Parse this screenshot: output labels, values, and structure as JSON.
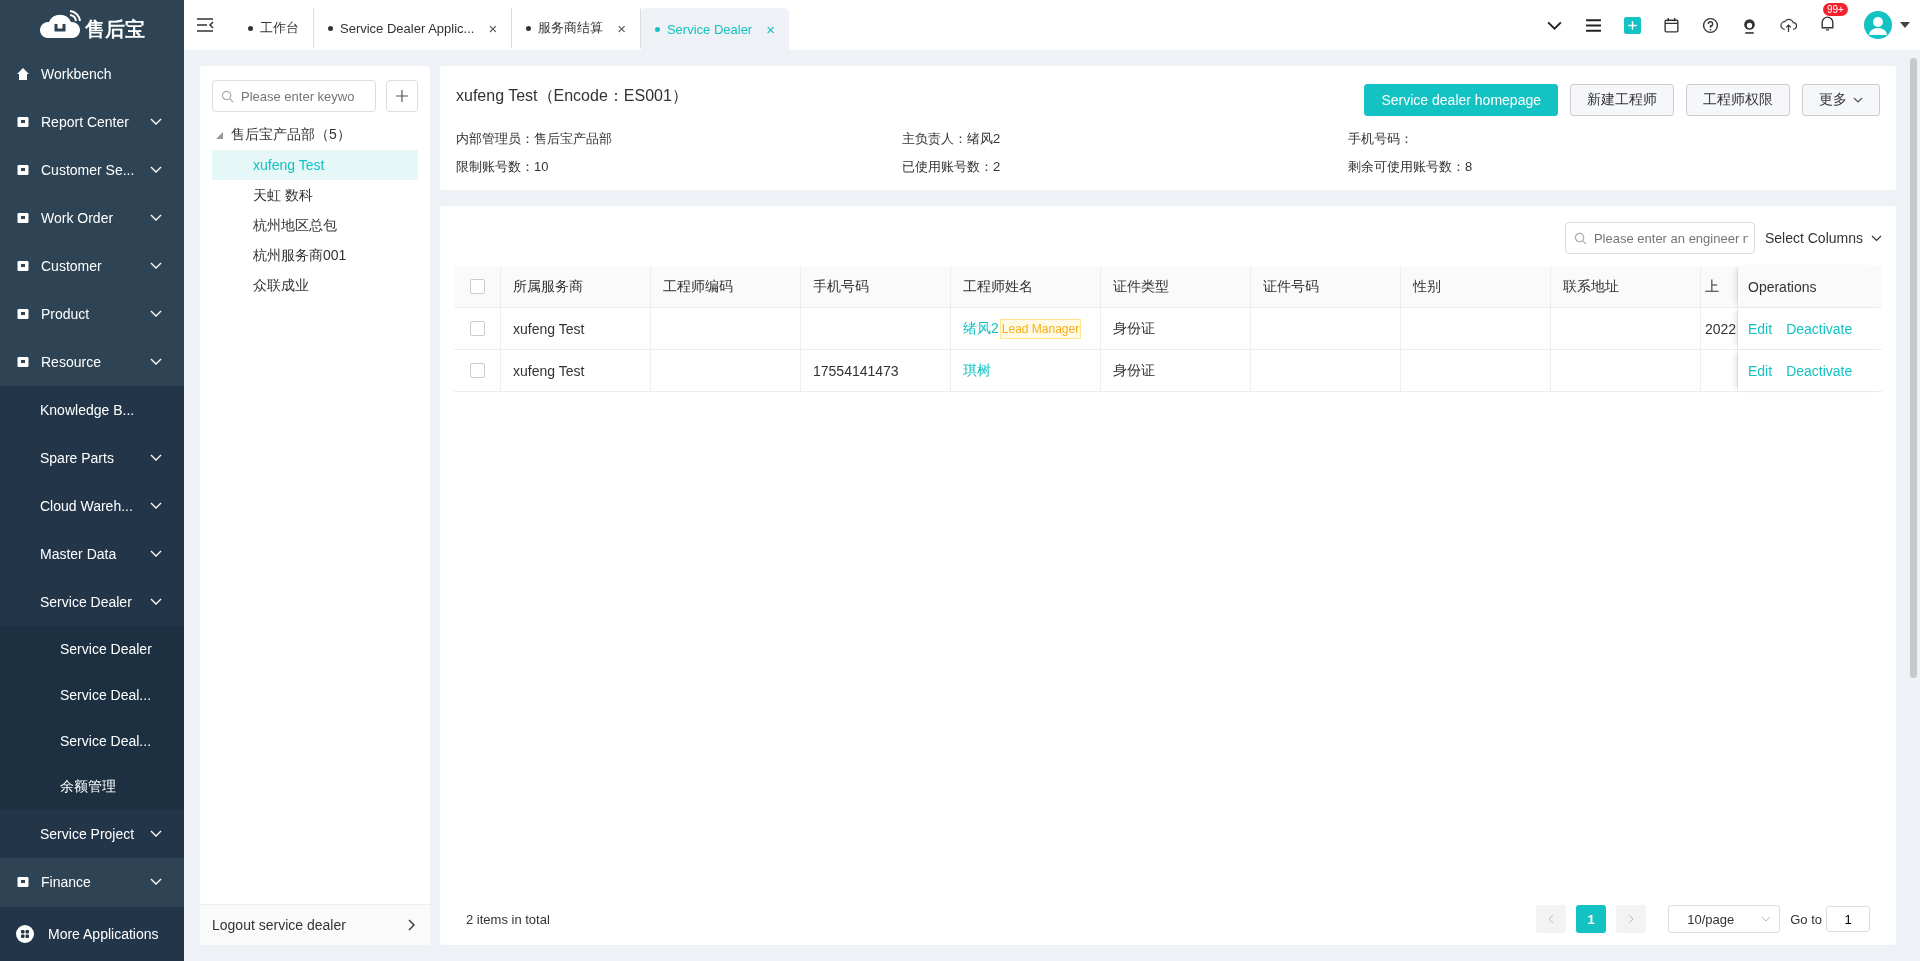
{
  "logo": {
    "text": "售后宝"
  },
  "sidebar": {
    "items": [
      {
        "label": "Workbench",
        "expandable": false
      },
      {
        "label": "Report Center",
        "expandable": true
      },
      {
        "label": "Customer Se...",
        "expandable": true
      },
      {
        "label": "Work Order",
        "expandable": true
      },
      {
        "label": "Customer",
        "expandable": true
      },
      {
        "label": "Product",
        "expandable": true
      },
      {
        "label": "Resource",
        "expandable": true,
        "children": [
          {
            "label": "Knowledge B...",
            "expandable": false
          },
          {
            "label": "Spare Parts",
            "expandable": true
          },
          {
            "label": "Cloud Wareh...",
            "expandable": true
          },
          {
            "label": "Master Data",
            "expandable": true
          },
          {
            "label": "Service Dealer",
            "expandable": true,
            "children": [
              {
                "label": "Service Dealer"
              },
              {
                "label": "Service Deal..."
              },
              {
                "label": "Service Deal..."
              },
              {
                "label": "余额管理"
              }
            ]
          },
          {
            "label": "Service Project",
            "expandable": true
          }
        ]
      },
      {
        "label": "Finance",
        "expandable": true
      }
    ],
    "footer": "More Applications"
  },
  "tabs": [
    {
      "label": "工作台",
      "selected": false
    },
    {
      "label": "Service Dealer Applic...",
      "selected": false,
      "close": "×"
    },
    {
      "label": "服务商结算",
      "selected": false,
      "close": "×"
    },
    {
      "label": "Service Dealer",
      "selected": true,
      "close": "×"
    }
  ],
  "notifications": {
    "badge": "99+"
  },
  "tree": {
    "search": {
      "placeholder": "Please enter keywo"
    },
    "root": {
      "label": "售后宝产品部（5）",
      "expanded": true,
      "children": [
        {
          "label": "xufeng Test",
          "selected": true
        },
        {
          "label": "天虹 数科",
          "selected": false
        },
        {
          "label": "杭州地区总包",
          "selected": false
        },
        {
          "label": "杭州服务商001",
          "selected": false
        },
        {
          "label": "众联成业",
          "selected": false
        }
      ]
    },
    "footer": "Logout service dealer"
  },
  "dealer": {
    "title": "xufeng Test（Encode：ES001）",
    "buttons": [
      {
        "label": "Service dealer homepage",
        "kind": "primary"
      },
      {
        "label": "新建工程师",
        "kind": "plain"
      },
      {
        "label": "工程师权限",
        "kind": "plain"
      },
      {
        "label": "更多",
        "kind": "dropdown"
      }
    ],
    "fields": [
      "内部管理员：售后宝产品部",
      "主负责人：绪风2",
      "手机号码：",
      "限制账号数：10",
      "已使用账号数：2",
      "剩余可使用账号数：8"
    ]
  },
  "table": {
    "search": {
      "placeholder": "Please enter an engineer n"
    },
    "select_columns": "Select Columns",
    "all_checked": false,
    "columns": [
      "所属服务商",
      "工程师编码",
      "手机号码",
      "工程师姓名",
      "证件类型",
      "证件号码",
      "性别",
      "联系地址",
      "上"
    ],
    "operations_header": "Operations",
    "rows": [
      {
        "checked": false,
        "cells": [
          "xufeng Test",
          "",
          "",
          "绪风2",
          "身份证",
          "",
          "",
          "",
          "2022"
        ],
        "tag": "Lead Manager",
        "operations": [
          "Edit",
          "Deactivate"
        ]
      },
      {
        "checked": false,
        "cells": [
          "xufeng Test",
          "",
          "17554141473",
          "琪树",
          "身份证",
          "",
          "",
          "",
          ""
        ],
        "operations": [
          "Edit",
          "Deactivate"
        ]
      }
    ]
  },
  "pagination": {
    "total": "2 items in total",
    "pages": [
      {
        "label": "1",
        "selected": true
      }
    ],
    "page_size": "10/page",
    "goto_label": "Go to",
    "goto_value": "1"
  }
}
